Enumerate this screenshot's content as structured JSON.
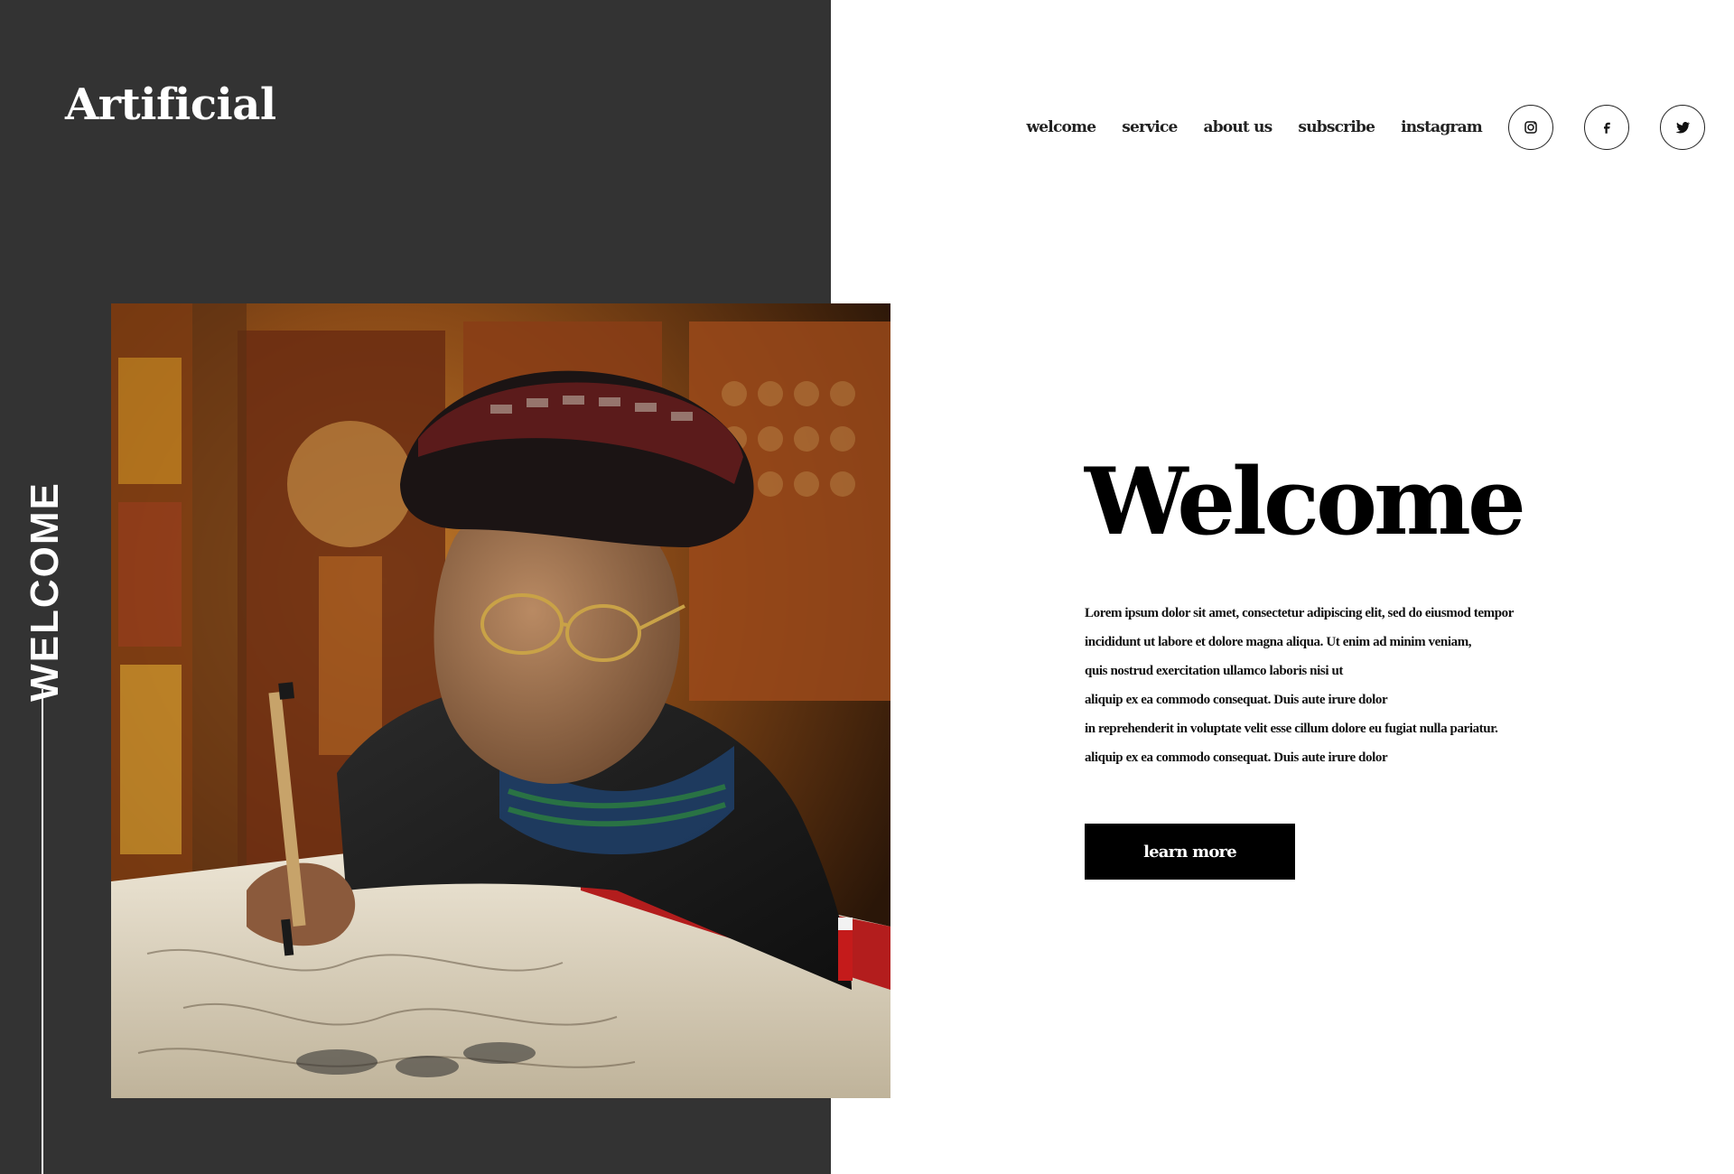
{
  "brand": {
    "logo": "Artificial"
  },
  "nav": {
    "links": [
      "welcome",
      "service",
      "about us",
      "subscribe",
      "instagram"
    ],
    "social": [
      "instagram-icon",
      "facebook-icon",
      "twitter-icon"
    ]
  },
  "side": {
    "label": "WELCOME"
  },
  "hero": {
    "headline": "Welcome",
    "body_lines": [
      "Lorem ipsum dolor sit amet, consectetur adipiscing elit, sed do eiusmod tempor",
      "incididunt ut labore et dolore magna aliqua. Ut enim ad minim veniam,",
      "quis nostrud exercitation ullamco laboris nisi ut",
      "aliquip ex ea commodo consequat. Duis aute irure dolor",
      "in reprehenderit in voluptate velit esse cillum dolore eu fugiat nulla pariatur.",
      "aliquip ex ea commodo consequat. Duis aute irure dolor"
    ],
    "cta": "learn more"
  },
  "colors": {
    "panel": "#333333",
    "accent": "#000000",
    "background": "#ffffff"
  }
}
